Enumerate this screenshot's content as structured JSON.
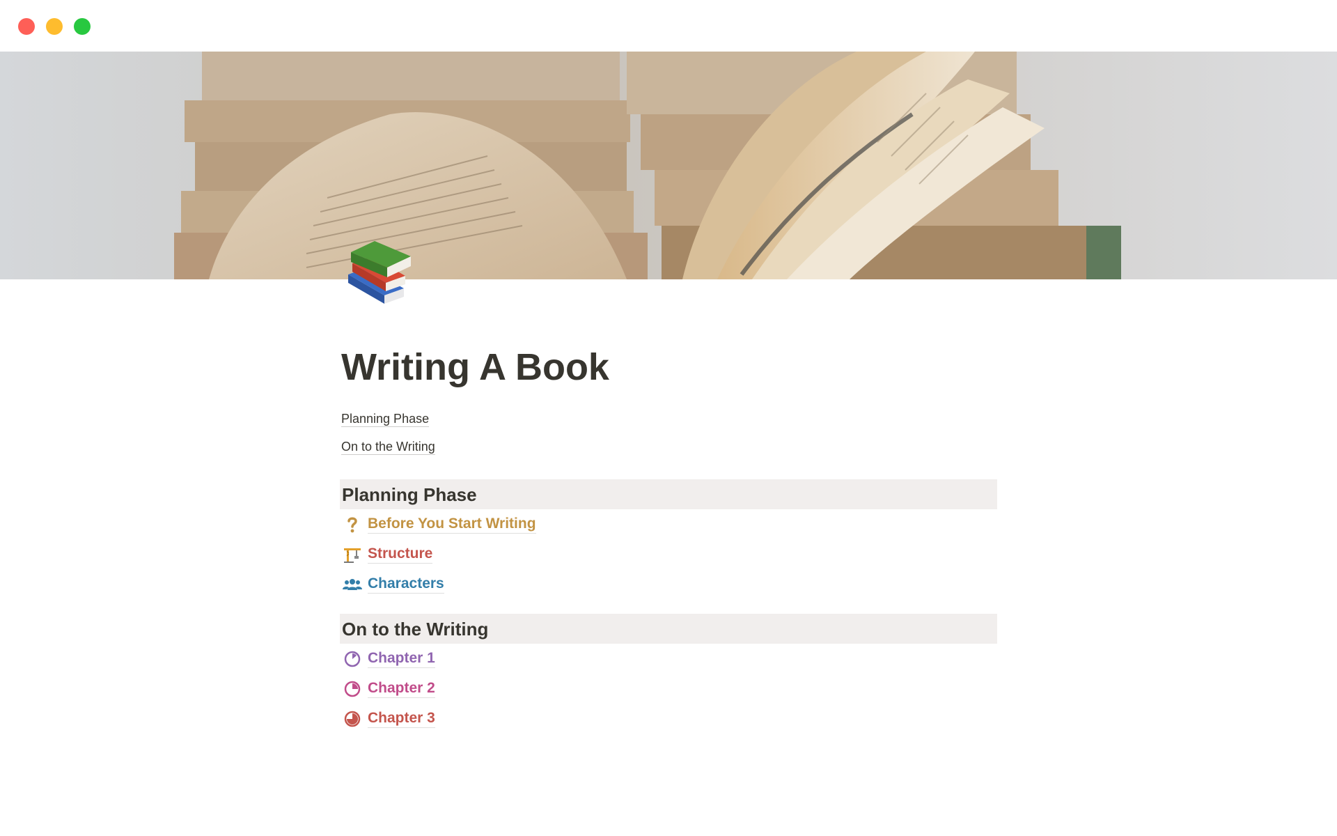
{
  "page": {
    "title": "Writing A Book"
  },
  "toc": [
    {
      "label": "Planning Phase"
    },
    {
      "label": "On to the Writing"
    }
  ],
  "sections": [
    {
      "heading": "Planning Phase",
      "links": [
        {
          "label": "Before You Start Writing",
          "icon": "question-mark-icon",
          "color": "#c29343"
        },
        {
          "label": "Structure",
          "icon": "crane-icon",
          "color": "#c4554d"
        },
        {
          "label": "Characters",
          "icon": "people-icon",
          "color": "#337ea9"
        }
      ]
    },
    {
      "heading": "On to the Writing",
      "links": [
        {
          "label": "Chapter 1",
          "icon": "progress-quarter-icon",
          "color": "#9065b0"
        },
        {
          "label": "Chapter 2",
          "icon": "progress-half-icon",
          "color": "#c14c8a"
        },
        {
          "label": "Chapter 3",
          "icon": "progress-three-quarter-icon",
          "color": "#c4554d"
        }
      ]
    }
  ],
  "colors": {
    "heading_bg": "#f1eeed",
    "text": "#37352f",
    "traffic_close": "#fe5f57",
    "traffic_min": "#febc2e",
    "traffic_max": "#28c840"
  }
}
